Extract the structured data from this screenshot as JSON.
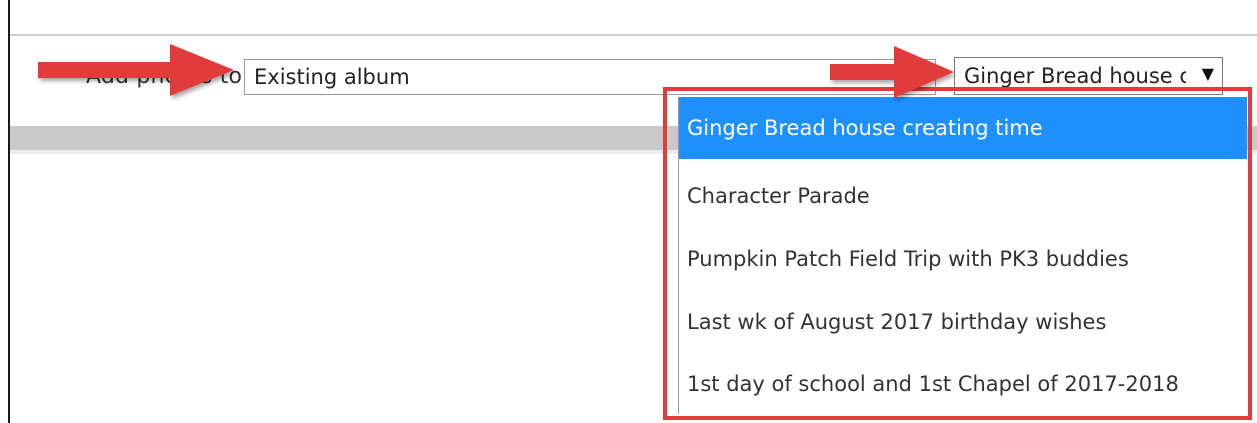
{
  "form": {
    "add_label": "Add photos to",
    "album_type_value": "Existing album",
    "album_value": "Ginger Bread house creating time"
  },
  "dropdown": {
    "options": [
      {
        "label": "Ginger Bread house creating time",
        "selected": true
      },
      {
        "label": "Character Parade",
        "selected": false
      },
      {
        "label": "Pumpkin Patch Field Trip with PK3 buddies",
        "selected": false
      },
      {
        "label": "Last wk of August 2017 birthday wishes",
        "selected": false
      },
      {
        "label": "1st day of school and 1st Chapel of 2017-2018",
        "selected": false
      }
    ]
  },
  "icons": {
    "caret": "chevron-down-icon",
    "annotation_arrow": "red-arrow-icon"
  },
  "colors": {
    "selected_bg": "#1e90ff",
    "annotation_red": "#e23b3b"
  }
}
